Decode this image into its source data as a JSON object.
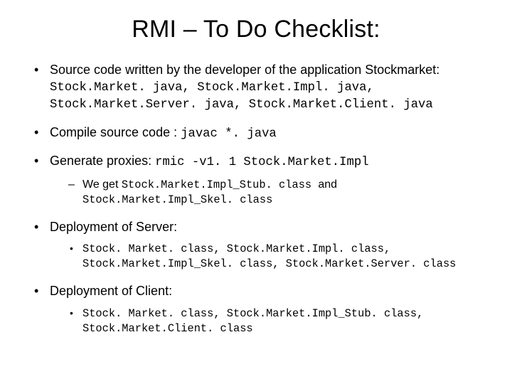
{
  "title": "RMI – To Do Checklist:",
  "items": [
    {
      "lead": "Source  code written by the developer of the application Stockmarket: ",
      "code": "Stock.Market. java, Stock.Market.Impl. java, Stock.Market.Server. java, Stock.Market.Client. java",
      "sub": null
    },
    {
      "lead": "Compile source code : ",
      "code": "javac *. java",
      "sub": null
    },
    {
      "lead": "Generate proxies: ",
      "code": "rmic -v1. 1 Stock.Market.Impl",
      "sub": {
        "style": "dash",
        "items": [
          {
            "pre": "We get ",
            "code1": "Stock.Market.Impl_Stub. class ",
            "mid": "and ",
            "code2": "Stock.Market.Impl_Skel. class"
          }
        ]
      }
    },
    {
      "lead": "Deployment of Server:",
      "code": "",
      "sub": {
        "style": "dot",
        "items": [
          {
            "code1": "Stock. Market. class, Stock.Market.Impl. class, Stock.Market.Impl_Skel. class, Stock.Market.Server. class"
          }
        ]
      }
    },
    {
      "lead": "Deployment of Client:",
      "code": "",
      "sub": {
        "style": "dot",
        "items": [
          {
            "code1": "Stock. Market. class, Stock.Market.Impl_Stub. class, Stock.Market.Client. class"
          }
        ]
      }
    }
  ]
}
